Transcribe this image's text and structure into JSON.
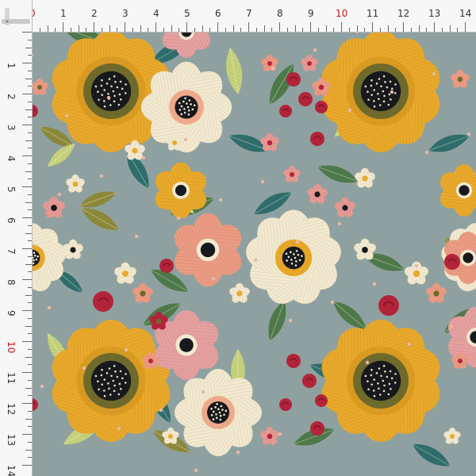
{
  "ruler": {
    "top_labels": [
      "0",
      "1",
      "2",
      "3",
      "4",
      "5",
      "6",
      "7",
      "8",
      "9",
      "10",
      "11",
      "12",
      "13",
      "14"
    ],
    "left_labels": [
      "1",
      "2",
      "3",
      "4",
      "5",
      "6",
      "7",
      "8",
      "9",
      "10",
      "11",
      "12",
      "13",
      "14"
    ],
    "highlight_labels": [
      "0",
      "10"
    ],
    "highlight_color": "#c0161b"
  },
  "fabric": {
    "background": "#8ea1a0",
    "colors": {
      "sunflower_petal": "#e9a92b",
      "sunflower_ring": "#6d6a2c",
      "sunflower_center": "#17191d",
      "cream_petal": "#f3e9cf",
      "pink_petal": "#e79a94",
      "rose": "#b5243a",
      "leaf_green": "#4f7a4a",
      "leaf_teal": "#2f6e6c",
      "leaf_olive": "#8e8a3a",
      "leaf_lime": "#c7d37b"
    },
    "motifs": [
      "sunflower-icon",
      "daisy-icon",
      "pink-blossom-icon",
      "rose-icon",
      "leaf-icon"
    ]
  }
}
